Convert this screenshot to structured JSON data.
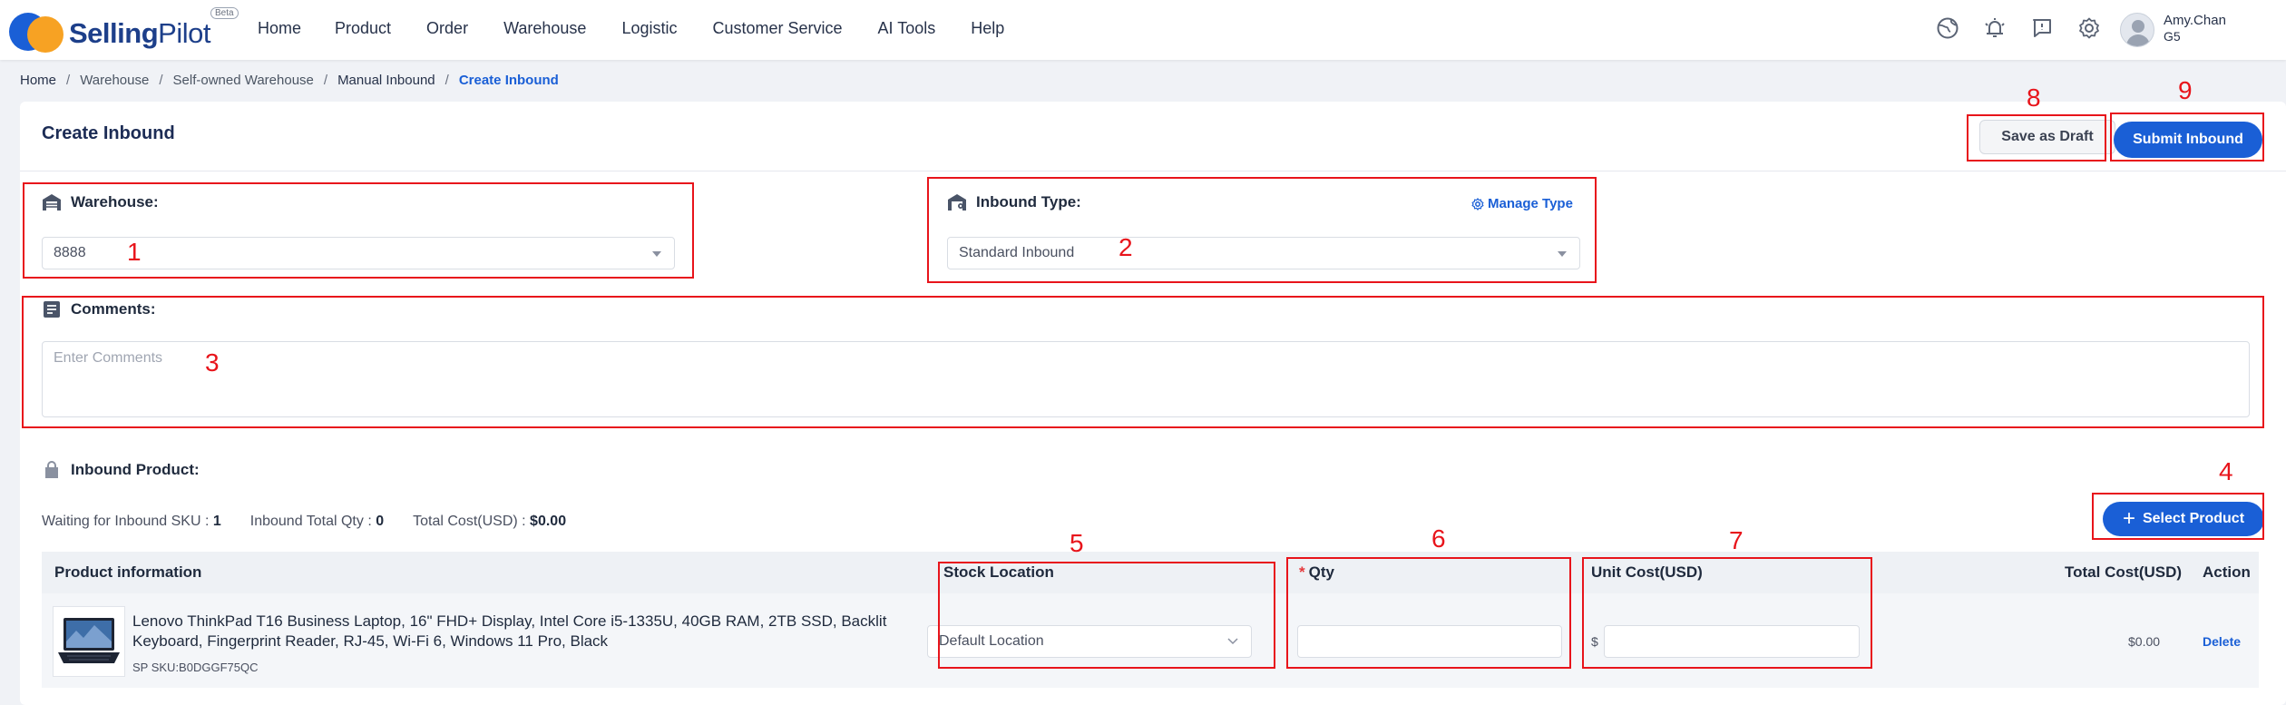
{
  "app": {
    "brand": "SellingPilot",
    "brand_bold": "Selling",
    "brand_light": "Pilot",
    "beta": "Beta",
    "accent": "#1a5fd6",
    "annotation_color": "#e8141b"
  },
  "nav": {
    "items": [
      "Home",
      "Product",
      "Order",
      "Warehouse",
      "Logistic",
      "Customer Service",
      "AI Tools",
      "Help"
    ],
    "icons": [
      "globe-icon",
      "bell-icon",
      "feedback-icon",
      "gear-icon"
    ]
  },
  "user": {
    "name": "Amy.Chan",
    "sub": "G5"
  },
  "breadcrumb": [
    "Home",
    "Warehouse",
    "Self-owned Warehouse",
    "Manual Inbound",
    "Create Inbound"
  ],
  "page": {
    "title": "Create Inbound",
    "save_draft": "Save as Draft",
    "submit": "Submit Inbound"
  },
  "form": {
    "warehouse_label": "Warehouse:",
    "warehouse_value": "8888",
    "inbound_type_label": "Inbound Type:",
    "inbound_type_value": "Standard Inbound",
    "manage_type": "Manage Type",
    "comments_label": "Comments:",
    "comments_placeholder": "Enter Comments"
  },
  "products": {
    "section_label": "Inbound Product:",
    "stats": [
      {
        "label": "Waiting for Inbound SKU :",
        "value": "1"
      },
      {
        "label": "Inbound Total Qty :",
        "value": "0"
      },
      {
        "label": "Total Cost(USD) :",
        "value": "$0.00"
      }
    ],
    "select_button": "Select Product",
    "columns": {
      "product": "Product information",
      "stock_location": "Stock Location",
      "qty": "Qty",
      "qty_required": "*",
      "unit_cost": "Unit Cost(USD)",
      "total_cost": "Total Cost(USD)",
      "action": "Action"
    },
    "rows": [
      {
        "name": "Lenovo ThinkPad T16 Business Laptop, 16\" FHD+ Display, Intel Core i5-1335U, 40GB RAM, 2TB SSD, Backlit Keyboard, Fingerprint Reader, RJ-45, Wi-Fi 6, Windows 11 Pro, Black",
        "sku": "SP SKU:B0DGGF75QC",
        "stock_location": "Default Location",
        "qty": "",
        "currency_symbol": "$",
        "unit_cost": "",
        "total_cost": "$0.00",
        "action": "Delete"
      }
    ]
  },
  "annotations": [
    "1",
    "2",
    "3",
    "4",
    "5",
    "6",
    "7",
    "8",
    "9"
  ]
}
